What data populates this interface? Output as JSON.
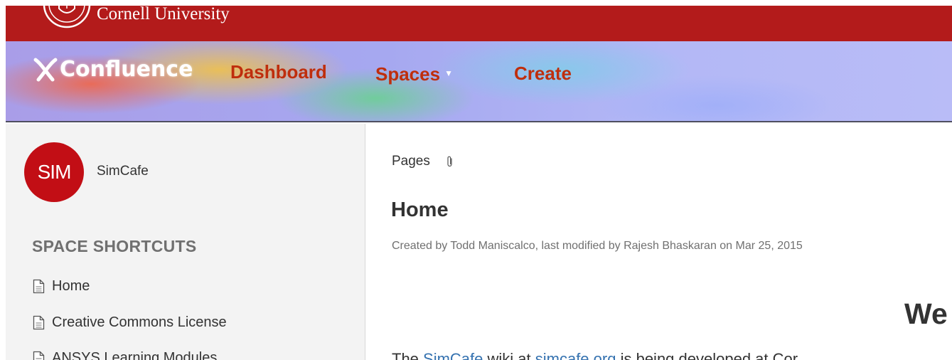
{
  "cornell": {
    "name": "Cornell University",
    "brand_color": "#b31b1b"
  },
  "nav": {
    "logo_text": "Confluence",
    "items": [
      {
        "label": "Dashboard"
      },
      {
        "label": "Spaces"
      },
      {
        "label": "Create"
      }
    ],
    "link_color": "#bf2e0d"
  },
  "sidebar": {
    "space_avatar": "SIM",
    "space_name": "SimCafe",
    "shortcuts_heading": "SPACE SHORTCUTS",
    "shortcuts": [
      {
        "label": "Home",
        "icon": "page-icon"
      },
      {
        "label": "Creative Commons License",
        "icon": "page-icon"
      },
      {
        "label": "ANSYS Learning Modules",
        "icon": "page-icon"
      }
    ]
  },
  "page": {
    "breadcrumb": "Pages",
    "title": "Home",
    "meta": "Created by Todd Maniscalco, last modified by Rajesh Bhaskaran on Mar 25, 2015",
    "heading_partial": "We",
    "body_partial": {
      "t1": "The ",
      "link1": "SimCafe",
      "t2": " wiki at ",
      "link2": "simcafe.org",
      "t3": " is being developed at Cor"
    },
    "link_color": "#3572b0"
  }
}
